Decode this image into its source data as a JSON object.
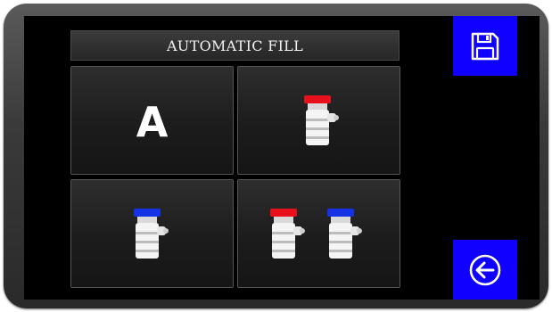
{
  "header": {
    "title": "AUTOMATIC FILL"
  },
  "modes": [
    {
      "id": "automatic",
      "label": "A",
      "icon": "text-a"
    },
    {
      "id": "high-side",
      "icon": "red-coupler-icon"
    },
    {
      "id": "low-side",
      "icon": "blue-coupler-icon"
    },
    {
      "id": "both-sides",
      "icon": "red-and-blue-couplers-icon"
    }
  ],
  "sidebar": {
    "save": {
      "icon": "floppy-disk-icon"
    },
    "back": {
      "icon": "back-arrow-icon"
    }
  },
  "colors": {
    "accent": "#0f00ff",
    "high_side": "#e8101a",
    "low_side": "#1632e6",
    "screen": "#000000"
  }
}
